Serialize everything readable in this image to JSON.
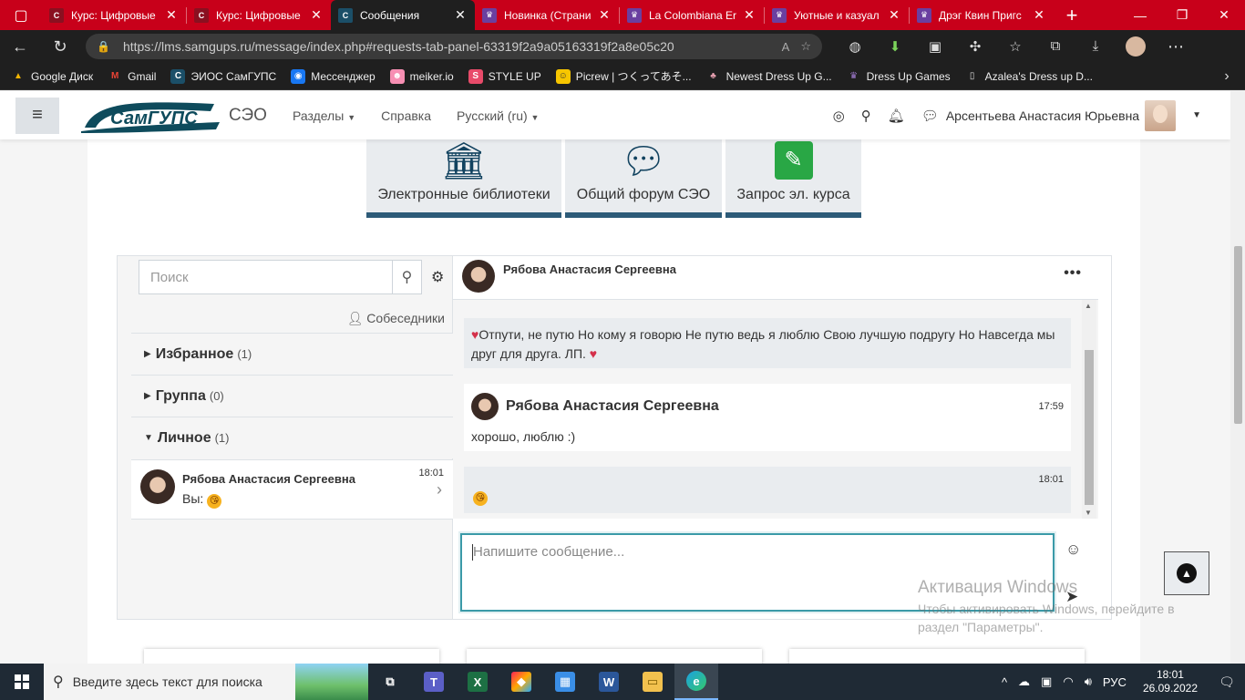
{
  "browser": {
    "tabs": [
      {
        "label": "Курс: Цифровые",
        "favicon_color": "#8a1020",
        "active": false
      },
      {
        "label": "Курс: Цифровые",
        "favicon_color": "#8a1020",
        "active": false
      },
      {
        "label": "Сообщения",
        "favicon_color": "#1b4f68",
        "active": true
      },
      {
        "label": "Новинка (Страни",
        "favicon_color": "#6a3fa0",
        "active": false
      },
      {
        "label": "La Colombiana Er",
        "favicon_color": "#6a3fa0",
        "active": false
      },
      {
        "label": "Уютные и казуал",
        "favicon_color": "#6a3fa0",
        "active": false
      },
      {
        "label": "Дрэг Квин Пригс",
        "favicon_color": "#6a3fa0",
        "active": false
      }
    ],
    "url": "https://lms.samgups.ru/message/index.php#requests-tab-panel-63319f2a9a05163319f2a8e05c20",
    "bookmarks": [
      {
        "label": "Google Диск",
        "color": "#f4b400"
      },
      {
        "label": "Gmail",
        "color": "#ea4335"
      },
      {
        "label": "ЭИОС СамГУПС",
        "color": "#1b4f68"
      },
      {
        "label": "Мессенджер",
        "color": "#1877f2"
      },
      {
        "label": "meiker.io",
        "color": "#f78fb3"
      },
      {
        "label": "STYLE UP",
        "color": "#e84b6a"
      },
      {
        "label": "Picrew | つくってあそ...",
        "color": "#f7c600"
      },
      {
        "label": "Newest Dress Up G...",
        "color": "#e7a0b0"
      },
      {
        "label": "Dress Up Games",
        "color": "#6a3fa0"
      },
      {
        "label": "Azalea's Dress up D...",
        "color": "#dddddd"
      }
    ]
  },
  "nav": {
    "brand": "СЭО",
    "logo_text": "СамГУПС",
    "links": [
      "Разделы",
      "Справка",
      "Русский (ru)"
    ],
    "user_name": "Арсентьева Анастасия Юрьевна"
  },
  "tiles": [
    {
      "label": "Электронные библиотеки",
      "icon": "library-icon"
    },
    {
      "label": "Общий форум СЭО",
      "icon": "chat-bubble-icon"
    },
    {
      "label": "Запрос эл. курса",
      "icon": "pencil-icon"
    }
  ],
  "messaging": {
    "search_placeholder": "Поиск",
    "contacts_label": "Собеседники",
    "sections": [
      {
        "label": "Избранное",
        "count": "(1)",
        "expanded": false
      },
      {
        "label": "Группа",
        "count": "(0)",
        "expanded": false
      },
      {
        "label": "Личное",
        "count": "(1)",
        "expanded": true
      }
    ],
    "conversation": {
      "name": "Рябова Анастасия Сергеевна",
      "time": "18:01",
      "preview": "Вы:"
    },
    "chat": {
      "contact_name": "Рябова Анастасия Сергеевна",
      "messages": [
        {
          "type": "in",
          "text": "Отпути, не путю Но кому я говорю Не путю ведь я люблю Свою лучшую подругу Но Навсегда мы друг для друга. ЛП."
        },
        {
          "type": "me",
          "sender": "Рябова Анастасия Сергеевна",
          "time": "17:59",
          "text": "хорошо, люблю :)"
        },
        {
          "type": "in",
          "time": "18:01",
          "text": ""
        }
      ],
      "composer_placeholder": "Напишите сообщение..."
    }
  },
  "watermark": {
    "title": "Активация Windows",
    "text": "Чтобы активировать Windows, перейдите в раздел \"Параметры\"."
  },
  "taskbar": {
    "search_placeholder": "Введите здесь текст для поиска",
    "lang": "РУС",
    "time": "18:01",
    "date": "26.09.2022"
  }
}
